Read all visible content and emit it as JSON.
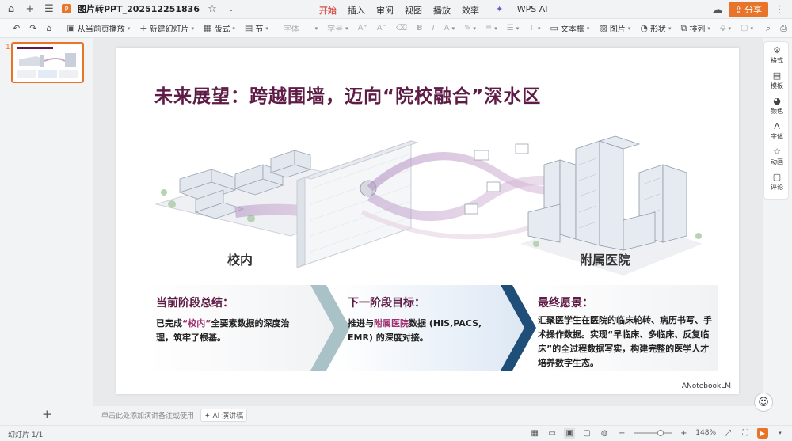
{
  "titlebar": {
    "doc_name": "图片转PPT_202512251836",
    "menu": [
      "开始",
      "插入",
      "审阅",
      "视图",
      "播放",
      "效率",
      "WPS AI"
    ],
    "active_menu": "开始",
    "share_label": "分享"
  },
  "ribbon": {
    "play_from_current": "从当前页播放",
    "new_slide": "新建幻灯片",
    "layout": "版式",
    "section": "节",
    "font_placeholder": "字体",
    "font_size_placeholder": "字号",
    "textbox": "文本框",
    "picture": "图片",
    "shape": "形状",
    "arrange": "排列"
  },
  "thumbnails": {
    "number": "1"
  },
  "slide": {
    "title": "未来展望：跨越围墙，迈向“院校融合”深水区",
    "label_campus": "校内",
    "label_hospital": "附属医院",
    "panel1": {
      "title": "当前阶段总结：",
      "text_pre": "已完成",
      "text_hl": "“校内”",
      "text_post": "全要素数据的深度治理，筑牢了根基。"
    },
    "panel2": {
      "title": "下一阶段目标：",
      "text_pre": "推进与",
      "text_hl": "附属医院",
      "text_post": "数据 (HIS,PACS, EMR) 的深度对接。"
    },
    "panel3": {
      "title": "最终愿景：",
      "text": "汇聚医学生在医院的临床轮转、病历书写、手术操作数据。实现“早临床、多临床、反复临床”的全过程数据写实，构建完整的医学人才培养数字生态。"
    },
    "watermark": "ANotebookLM"
  },
  "right_panel": [
    "格式",
    "模板",
    "颜色",
    "字体",
    "动画",
    "评论"
  ],
  "notes": {
    "placeholder": "单击此处添加演讲备注或使用",
    "ai_label": "AI 演讲稿"
  },
  "status": {
    "slide_info": "幻灯片 1/1",
    "zoom": "148%"
  },
  "colors": {
    "accent": "#e8742a",
    "title_purple": "#5e1b45",
    "highlight": "#a0306f"
  }
}
